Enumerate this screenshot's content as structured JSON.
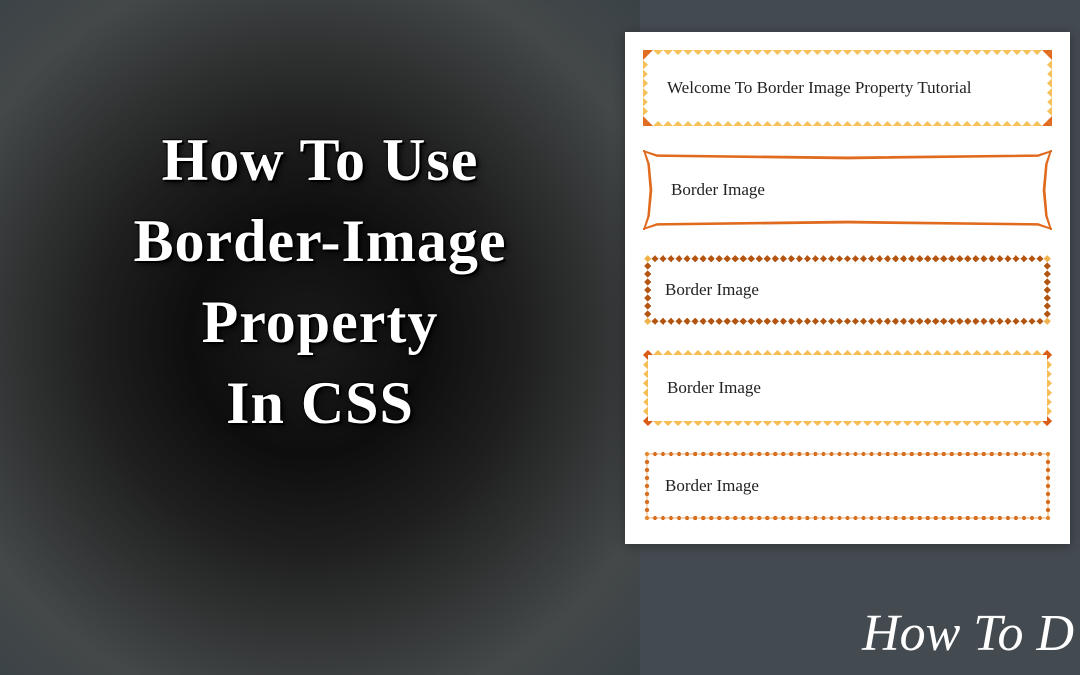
{
  "title": {
    "line1": "How To Use",
    "line2": "Border-Image",
    "line3": "Property",
    "line4": "In CSS"
  },
  "demo": {
    "boxes": [
      {
        "label": "Welcome To Border Image Property Tutorial"
      },
      {
        "label": "Border Image"
      },
      {
        "label": "Border Image"
      },
      {
        "label": "Border Image"
      },
      {
        "label": "Border Image"
      }
    ]
  },
  "watermark": "How To D"
}
